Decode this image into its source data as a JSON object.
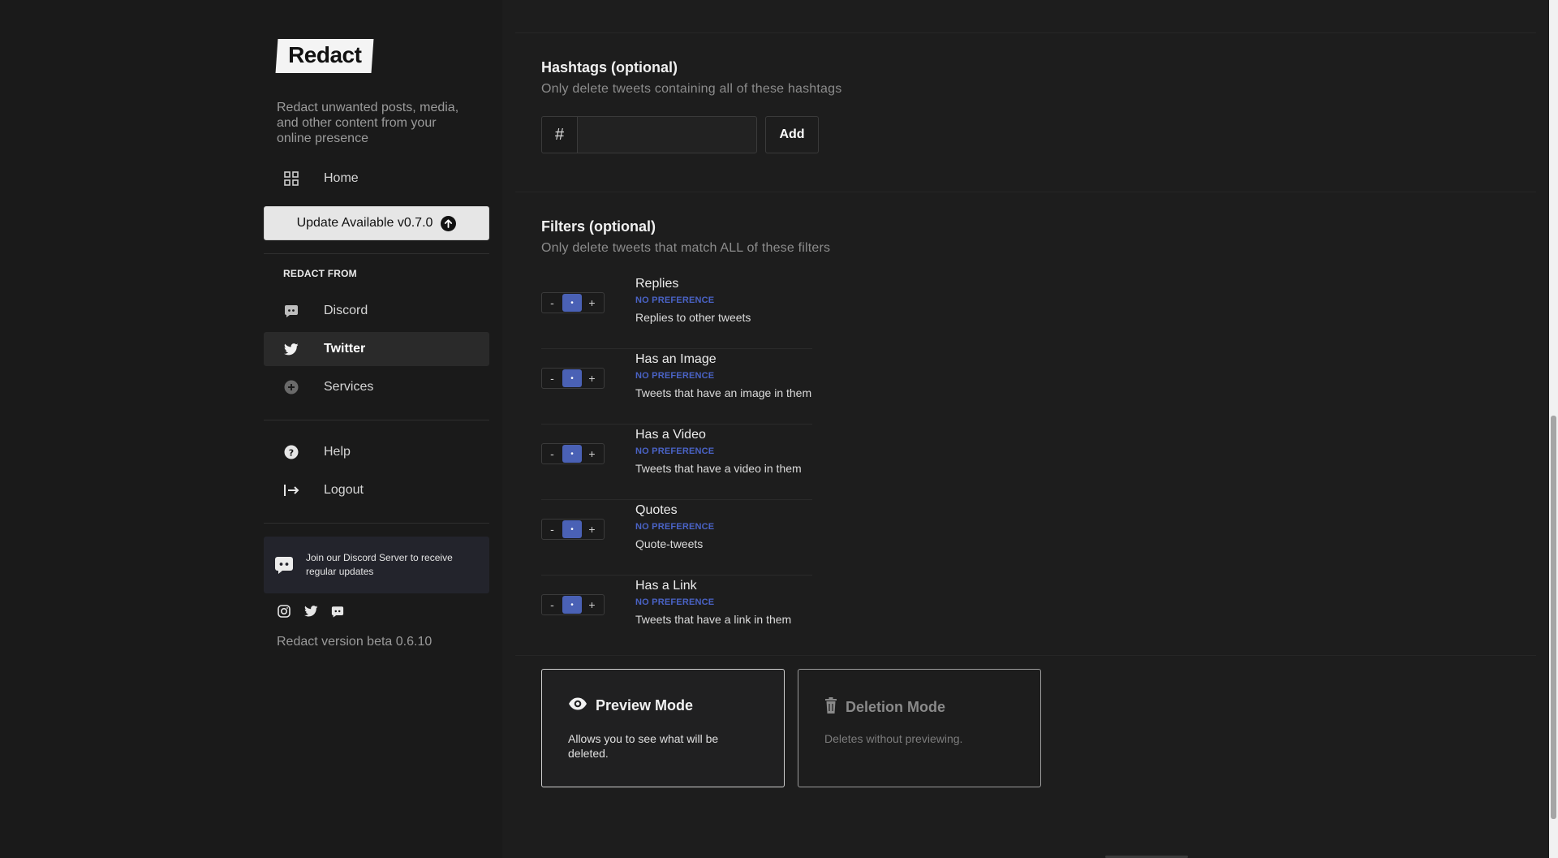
{
  "brand": {
    "logo": "Redact",
    "tagline": "Redact unwanted posts, media, and other content from your online presence"
  },
  "nav": {
    "home": "Home",
    "update_button": "Update Available v0.7.0",
    "section_label": "REDACT FROM",
    "discord": "Discord",
    "twitter": "Twitter",
    "services": "Services",
    "help": "Help",
    "logout": "Logout"
  },
  "discord_card": {
    "text": "Join our Discord Server to receive regular updates"
  },
  "version_text": "Redact version beta 0.6.10",
  "hashtags": {
    "title": "Hashtags (optional)",
    "subtitle": "Only delete tweets containing all of these hashtags",
    "prefix": "#",
    "input_value": "",
    "add_label": "Add"
  },
  "filters": {
    "title": "Filters (optional)",
    "subtitle": "Only delete tweets that match ALL of these filters",
    "tri_minus": "-",
    "tri_mid": "•",
    "tri_plus": "+",
    "items": [
      {
        "title": "Replies",
        "pref": "NO PREFERENCE",
        "desc": "Replies to other tweets"
      },
      {
        "title": "Has an Image",
        "pref": "NO PREFERENCE",
        "desc": "Tweets that have an image in them"
      },
      {
        "title": "Has a Video",
        "pref": "NO PREFERENCE",
        "desc": "Tweets that have a video in them"
      },
      {
        "title": "Quotes",
        "pref": "NO PREFERENCE",
        "desc": "Quote-tweets"
      },
      {
        "title": "Has a Link",
        "pref": "NO PREFERENCE",
        "desc": "Tweets that have a link in them"
      }
    ]
  },
  "modes": {
    "preview": {
      "title": "Preview Mode",
      "desc": "Allows you to see what will be deleted.",
      "selected": true
    },
    "deletion": {
      "title": "Deletion Mode",
      "desc": "Deletes without previewing.",
      "selected": false
    }
  },
  "colors": {
    "accent_blue": "#4a61b5",
    "pref_text": "#4a63c6",
    "background": "#1d1d1d",
    "sidebar": "#1a1a1a"
  }
}
